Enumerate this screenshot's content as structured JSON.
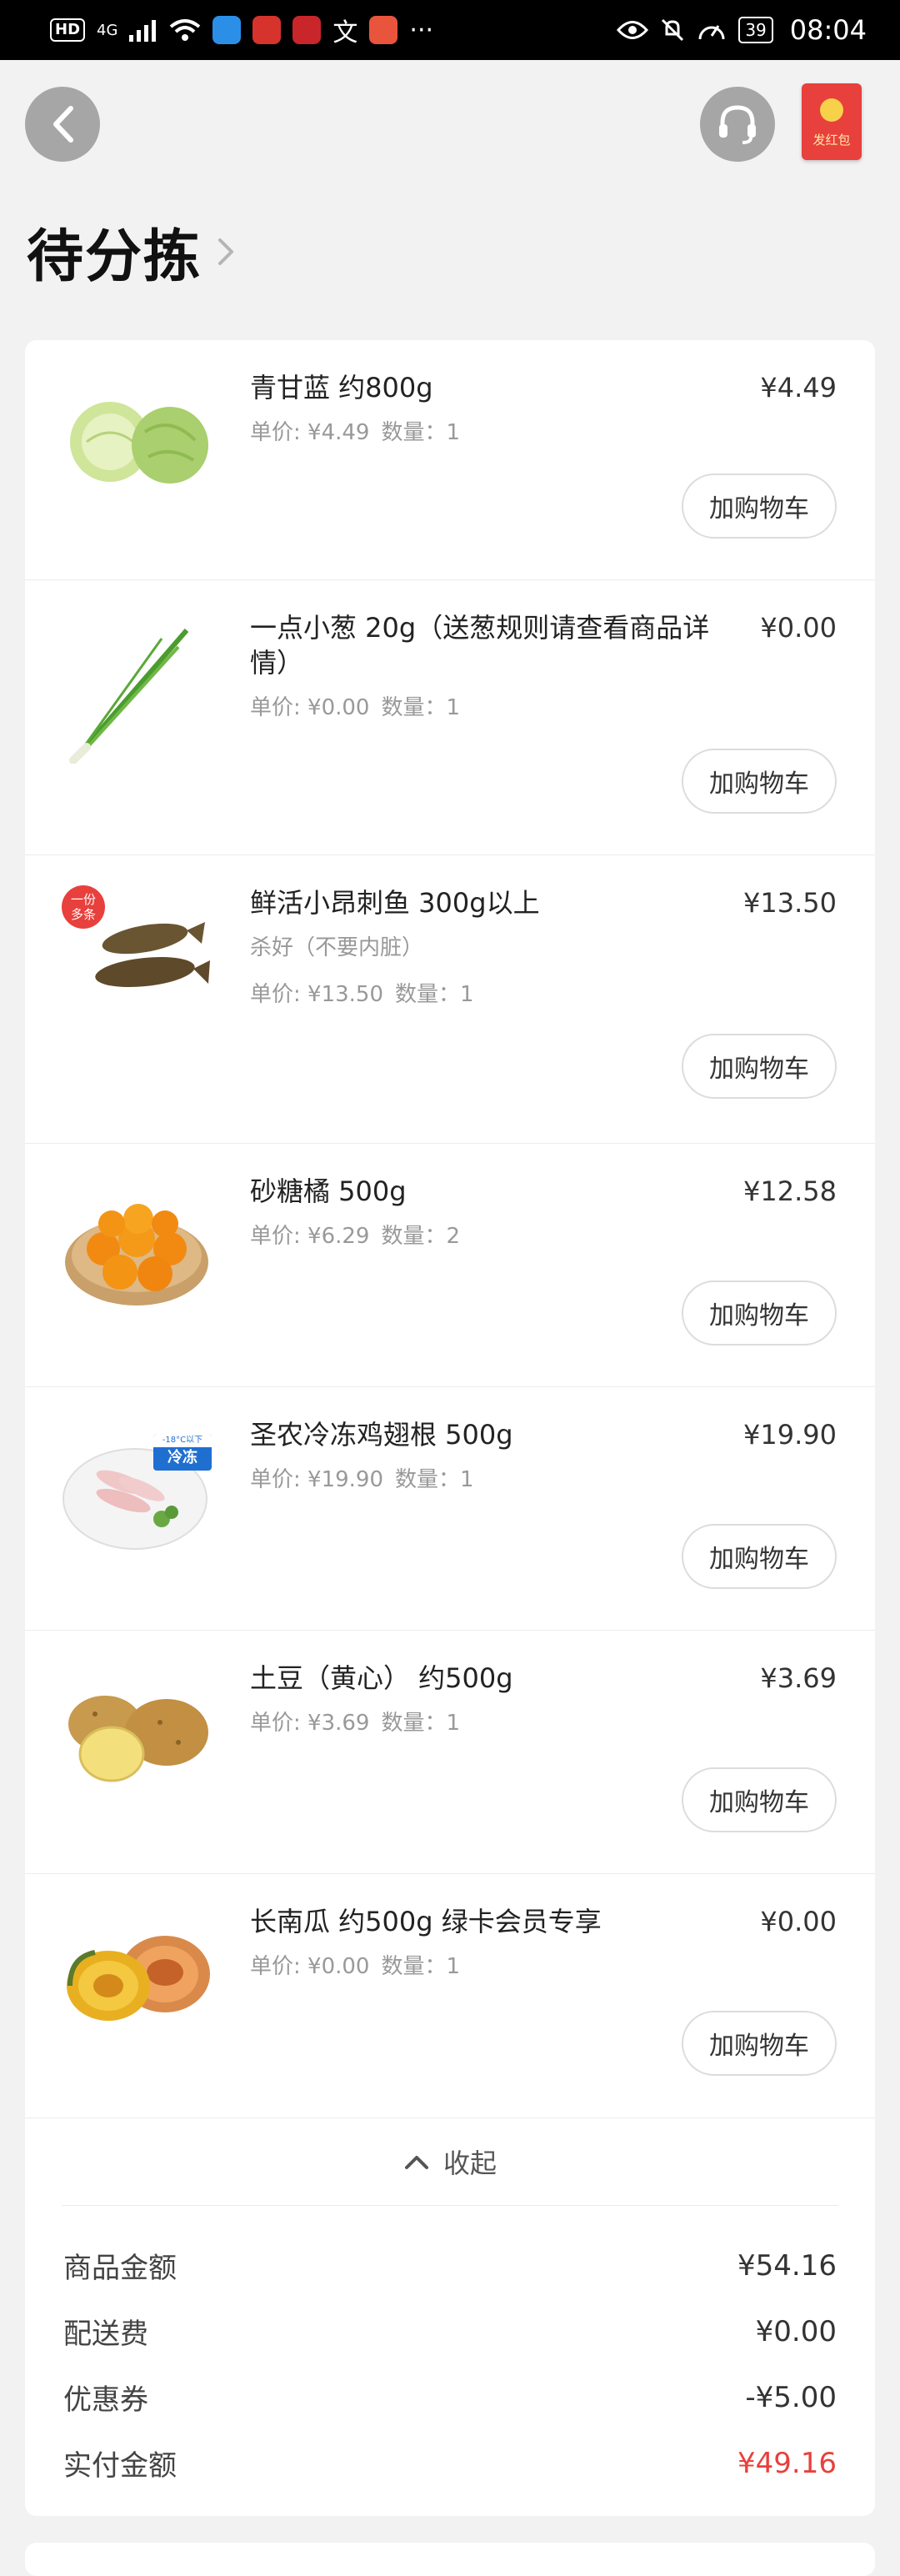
{
  "status_bar": {
    "hd": "HD",
    "network": "4G",
    "battery": "39",
    "time": "08:04"
  },
  "header": {
    "redpacket_label": "发红包"
  },
  "page": {
    "title": "待分拣"
  },
  "labels": {
    "unit_price": "单价: ",
    "quantity": "数量：",
    "add_to_cart": "加购物车",
    "collapse": "收起"
  },
  "items": [
    {
      "name": "青甘蓝 约800g",
      "price": "¥4.49",
      "note": "",
      "unit_price": "¥4.49",
      "qty": "1",
      "image": "cabbage"
    },
    {
      "name": "一点小葱 20g（送葱规则请查看商品详情）",
      "price": "¥0.00",
      "note": "",
      "unit_price": "¥0.00",
      "qty": "1",
      "image": "scallion"
    },
    {
      "name": "鲜活小昂刺鱼 300g以上",
      "price": "¥13.50",
      "note": "杀好（不要内脏）",
      "unit_price": "¥13.50",
      "qty": "1",
      "image": "fish",
      "image_badge": "一份多条"
    },
    {
      "name": "砂糖橘 500g",
      "price": "¥12.58",
      "note": "",
      "unit_price": "¥6.29",
      "qty": "2",
      "image": "mandarins"
    },
    {
      "name": "圣农冷冻鸡翅根 500g",
      "price": "¥19.90",
      "note": "",
      "unit_price": "¥19.90",
      "qty": "1",
      "image": "chicken",
      "image_badge": "冷冻",
      "image_badge_small": "-18°C以下"
    },
    {
      "name": "土豆（黄心） 约500g",
      "price": "¥3.69",
      "note": "",
      "unit_price": "¥3.69",
      "qty": "1",
      "image": "potato"
    },
    {
      "name": "长南瓜 约500g 绿卡会员专享",
      "price": "¥0.00",
      "note": "",
      "unit_price": "¥0.00",
      "qty": "1",
      "image": "pumpkin"
    }
  ],
  "summary": {
    "goods_label": "商品金额",
    "goods_value": "¥54.16",
    "delivery_label": "配送费",
    "delivery_value": "¥0.00",
    "coupon_label": "优惠券",
    "coupon_value": "-¥5.00",
    "paid_label": "实付金额",
    "paid_value": "¥49.16"
  },
  "colors": {
    "accent_red": "#e8403c",
    "muted": "#999999"
  }
}
